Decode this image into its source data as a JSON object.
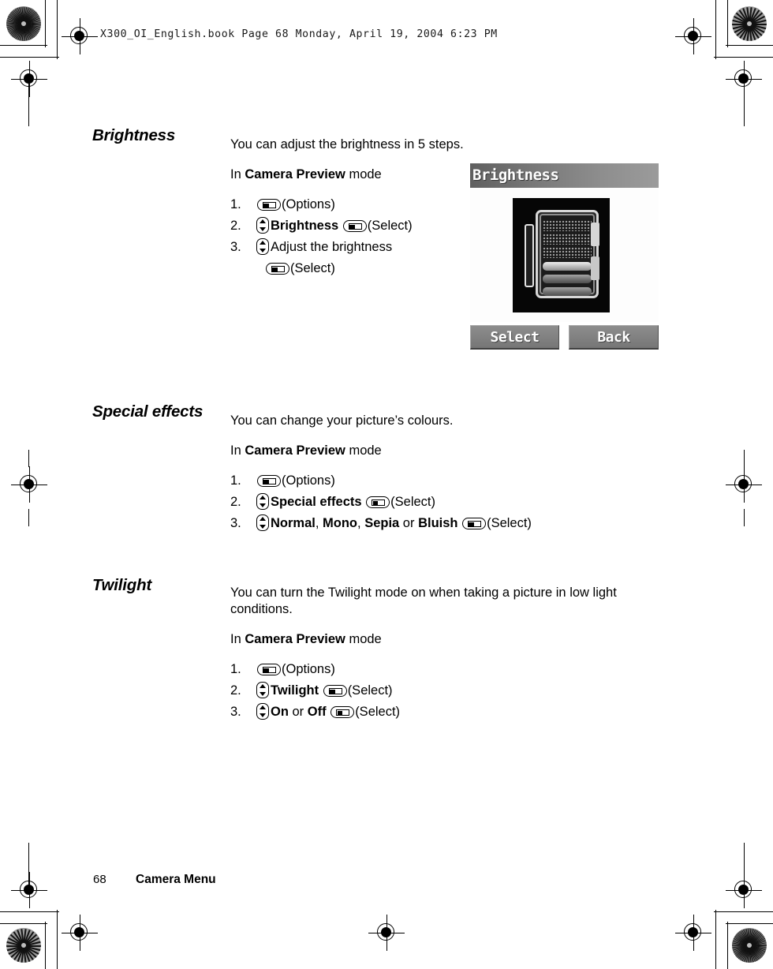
{
  "doc_header": "X300_OI_English.book  Page 68  Monday, April 19, 2004  6:23 PM",
  "sections": [
    {
      "heading": "Brightness",
      "intro": "You can adjust the brightness in 5 steps.",
      "mode_prefix": "In ",
      "mode_bold": "Camera Preview",
      "mode_suffix": " mode",
      "steps": [
        {
          "num": "1.",
          "keys": [
            "soft"
          ],
          "text": "(Options)"
        },
        {
          "num": "2.",
          "keys": [
            "nav"
          ],
          "bold": "Brightness",
          "text": "(Select)"
        },
        {
          "num": "3.",
          "keys": [
            "nav"
          ],
          "text": "Adjust the brightness",
          "sub": "(Select)"
        }
      ]
    },
    {
      "heading": "Special effects",
      "intro": "You can change your picture’s colours.",
      "mode_prefix": "In ",
      "mode_bold": "Camera Preview",
      "mode_suffix": " mode",
      "steps": [
        {
          "num": "1.",
          "keys": [
            "soft"
          ],
          "text": "(Options)"
        },
        {
          "num": "2.",
          "keys": [
            "nav"
          ],
          "bold": "Special effects",
          "text": "(Select)"
        },
        {
          "num": "3.",
          "keys": [
            "nav"
          ],
          "options": [
            "Normal",
            "Mono",
            "Sepia",
            "Bluish"
          ],
          "text": "(Select)"
        }
      ]
    },
    {
      "heading": "Twilight",
      "intro": "You can turn the Twilight mode on when taking a picture in low light conditions.",
      "mode_prefix": "In ",
      "mode_bold": "Camera Preview",
      "mode_suffix": " mode",
      "steps": [
        {
          "num": "1.",
          "keys": [
            "soft"
          ],
          "text": "(Options)"
        },
        {
          "num": "2.",
          "keys": [
            "nav"
          ],
          "bold": "Twilight",
          "text": "(Select)"
        },
        {
          "num": "3.",
          "keys": [
            "nav"
          ],
          "options": [
            "On",
            "Off"
          ],
          "text": "(Select)"
        }
      ]
    }
  ],
  "brightness_numbers": {
    "step_count": "5"
  },
  "phone_screen": {
    "title": "Brightness",
    "softkey_left": "Select",
    "softkey_right": "Back"
  },
  "footer": {
    "page_number": "68",
    "chapter": "Camera Menu"
  },
  "step_labels": {
    "s1_num": "1.",
    "s2_num": "2.",
    "s3_num": "3."
  },
  "literals": {
    "options": "(Options)",
    "select": "(Select)",
    "comma": ", ",
    "or": " or ",
    "space": " "
  },
  "colors": {
    "text": "#000000",
    "screen_title_bar": "#7a7a7a",
    "screen_softkey": "#808080",
    "photo_bg": "#060606",
    "paper": "#ffffff"
  }
}
